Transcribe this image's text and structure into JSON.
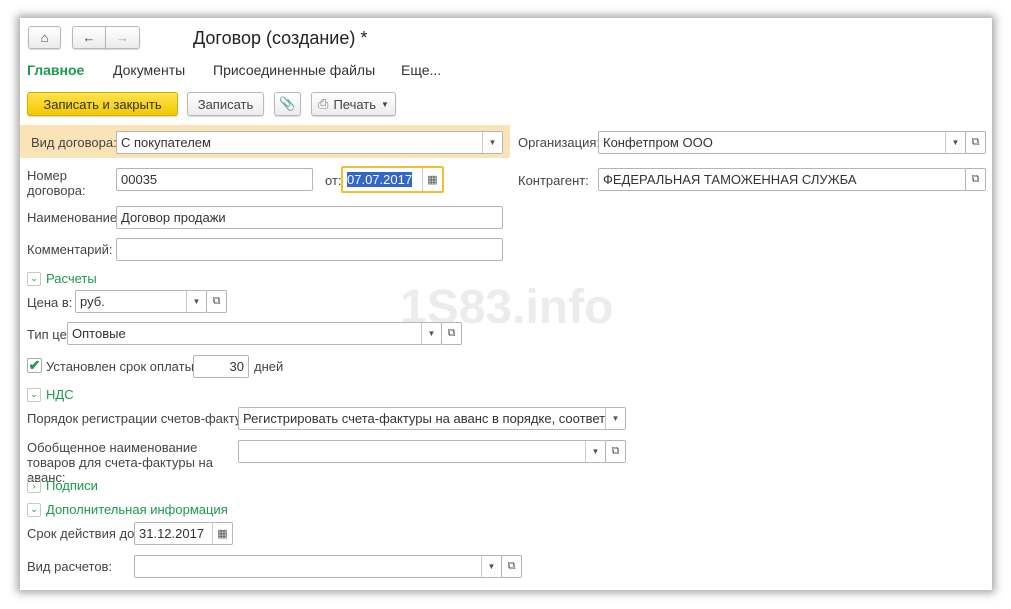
{
  "title": "Договор (создание) *",
  "tabs": [
    "Главное",
    "Документы",
    "Присоединенные файлы",
    "Еще..."
  ],
  "toolbar": {
    "save_close": "Записать и закрыть",
    "save": "Записать",
    "print": "Печать"
  },
  "form": {
    "contract_type_label": "Вид договора:",
    "contract_type": "С покупателем",
    "org_label": "Организация:",
    "org": "Конфетпром ООО",
    "number_label": "Номер договора:",
    "number": "00035",
    "date_label": "от:",
    "date": "07.07.2017",
    "counterparty_label": "Контрагент:",
    "counterparty": "ФЕДЕРАЛЬНАЯ ТАМОЖЕННАЯ СЛУЖБА",
    "name_label": "Наименование:",
    "name": "Договор продажи",
    "comment_label": "Комментарий:",
    "comment": ""
  },
  "payments": {
    "header": "Расчеты",
    "currency_label": "Цена в:",
    "currency": "руб.",
    "price_type_label": "Тип цен:",
    "price_type": "Оптовые",
    "term_label": "Установлен срок оплаты",
    "term_checked": true,
    "term_days": "30",
    "days_label": "дней"
  },
  "vat": {
    "header": "НДС",
    "order_label": "Порядок регистрации счетов-фактур:",
    "order": "Регистрировать счета-фактуры на аванс в порядке, соответству",
    "generic_label": "Обобщенное наименование товаров для счета-фактуры на аванс:",
    "generic": ""
  },
  "signatures": {
    "header": "Подписи"
  },
  "extra": {
    "header": "Дополнительная информация",
    "valid_label": "Срок действия до:",
    "valid": "31.12.2017",
    "settle_label": "Вид расчетов:",
    "settle": ""
  },
  "watermark": "1S83.info",
  "colors": {
    "accent": "#1a9a4a",
    "primary_button": "#f5cc0a",
    "highlight": "#fbe3b8"
  }
}
